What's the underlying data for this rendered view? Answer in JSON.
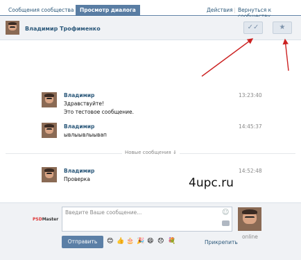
{
  "tabs": [
    {
      "label": "Сообщения сообщества"
    },
    {
      "label": "Просмотр диалога"
    }
  ],
  "tab_actions": {
    "actions": "Действия",
    "back": "Вернуться к сообществу"
  },
  "header": {
    "name": "Владимир Трофименко"
  },
  "messages": [
    {
      "name": "Владимир",
      "time": "13:23:40",
      "lines": [
        "Здравствуйте!",
        "Это тестовое сообщение."
      ]
    },
    {
      "name": "Владимир",
      "time": "14:45:37",
      "lines": [
        "ывлыывлыывап"
      ]
    },
    {
      "name": "Владимир",
      "time": "14:52:48",
      "lines": [
        "Проверка"
      ]
    }
  ],
  "new_messages_label": "Новые сообщения",
  "watermark": "4upc.ru",
  "compose": {
    "placeholder": "Введите Ваше сообщение...",
    "send_label": "Отправить",
    "attach_label": "Прикрепить",
    "online_label": "online",
    "emojis": [
      "😊",
      "👍",
      "🎂",
      "🎉",
      "😄",
      "😞",
      "💐"
    ]
  },
  "logo": {
    "part1": "PSD",
    "part2": "Master"
  },
  "colors": {
    "accent": "#597da3",
    "link": "#2b587a",
    "arrow": "#cc2222"
  }
}
